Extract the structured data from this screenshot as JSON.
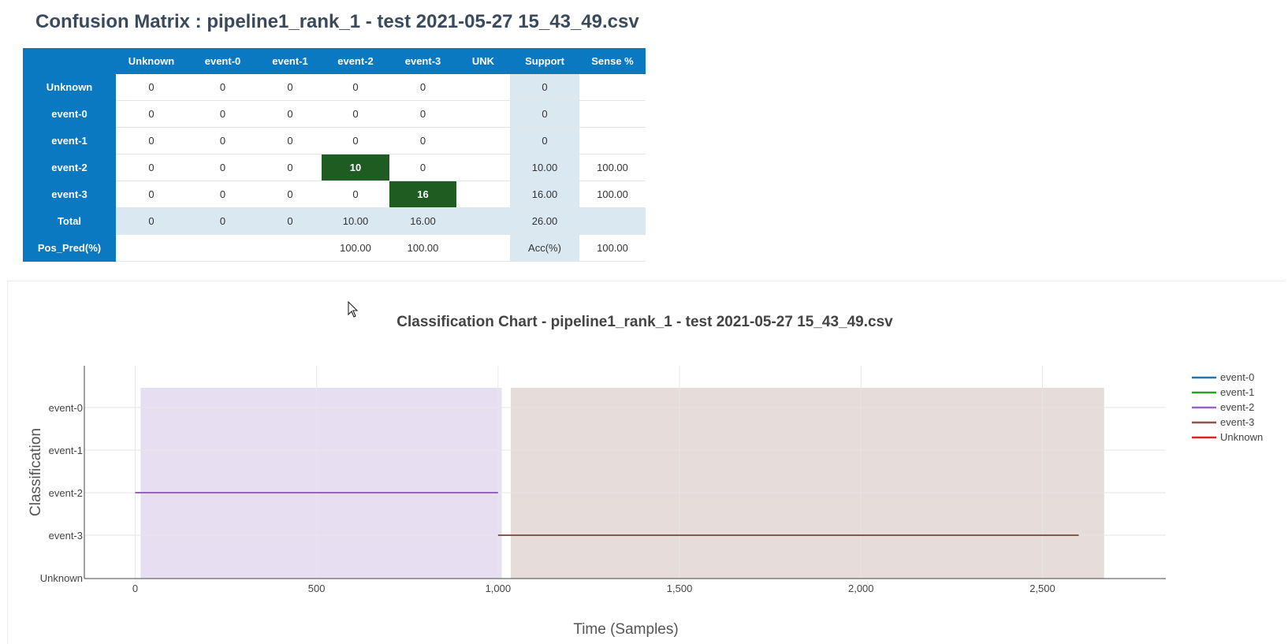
{
  "confusion_matrix": {
    "title": "Confusion Matrix : pipeline1_rank_1 - test 2021-05-27 15_43_49.csv",
    "columns": [
      "Unknown",
      "event-0",
      "event-1",
      "event-2",
      "event-3",
      "UNK",
      "Support",
      "Sense %"
    ],
    "rows": [
      {
        "label": "Unknown",
        "cells": [
          "0",
          "0",
          "0",
          "0",
          "0",
          "",
          "0",
          ""
        ]
      },
      {
        "label": "event-0",
        "cells": [
          "0",
          "0",
          "0",
          "0",
          "0",
          "",
          "0",
          ""
        ]
      },
      {
        "label": "event-1",
        "cells": [
          "0",
          "0",
          "0",
          "0",
          "0",
          "",
          "0",
          ""
        ]
      },
      {
        "label": "event-2",
        "cells": [
          "0",
          "0",
          "0",
          "10",
          "0",
          "",
          "10.00",
          "100.00"
        ]
      },
      {
        "label": "event-3",
        "cells": [
          "0",
          "0",
          "0",
          "0",
          "16",
          "",
          "16.00",
          "100.00"
        ]
      },
      {
        "label": "Total",
        "cells": [
          "0",
          "0",
          "0",
          "10.00",
          "16.00",
          "",
          "26.00",
          ""
        ]
      },
      {
        "label": "Pos_Pred(%)",
        "cells": [
          "",
          "",
          "",
          "100.00",
          "100.00",
          "",
          "Acc(%)",
          "100.00"
        ]
      }
    ],
    "highlight_color": "#1e5c21",
    "header_color": "#0b79c1",
    "support_color": "#dae8f2"
  },
  "chart_data": {
    "type": "line",
    "title": "Classification Chart - pipeline1_rank_1 - test 2021-05-27 15_43_49.csv",
    "xlabel": "Time (Samples)",
    "ylabel": "Classification",
    "categories": [
      "event-0",
      "event-1",
      "event-2",
      "event-3",
      "Unknown"
    ],
    "xlim": [
      -140,
      2840
    ],
    "x_ticks": [
      0,
      500,
      1000,
      1500,
      2000,
      2500
    ],
    "x_tick_labels": [
      "0",
      "500",
      "1,000",
      "1,500",
      "2,000",
      "2,500"
    ],
    "legend_position": "top-right",
    "grid": true,
    "series": [
      {
        "name": "event-0",
        "color": "#1f77b4",
        "segments": []
      },
      {
        "name": "event-1",
        "color": "#2ca02c",
        "segments": []
      },
      {
        "name": "event-2",
        "color": "#9467bd",
        "segments": [
          {
            "x": [
              0,
              1000
            ],
            "y": "event-2"
          }
        ]
      },
      {
        "name": "event-3",
        "color": "#8c564b",
        "segments": [
          {
            "x": [
              1000,
              2600
            ],
            "y": "event-3"
          }
        ]
      },
      {
        "name": "Unknown",
        "color": "#d62728",
        "segments": []
      }
    ],
    "ground_truth_regions": [
      {
        "label": "event-2",
        "x": [
          15,
          1010
        ],
        "color": "#e8def2"
      },
      {
        "label": "event-3",
        "x": [
          1035,
          2670
        ],
        "color": "#e6dcda"
      }
    ]
  }
}
